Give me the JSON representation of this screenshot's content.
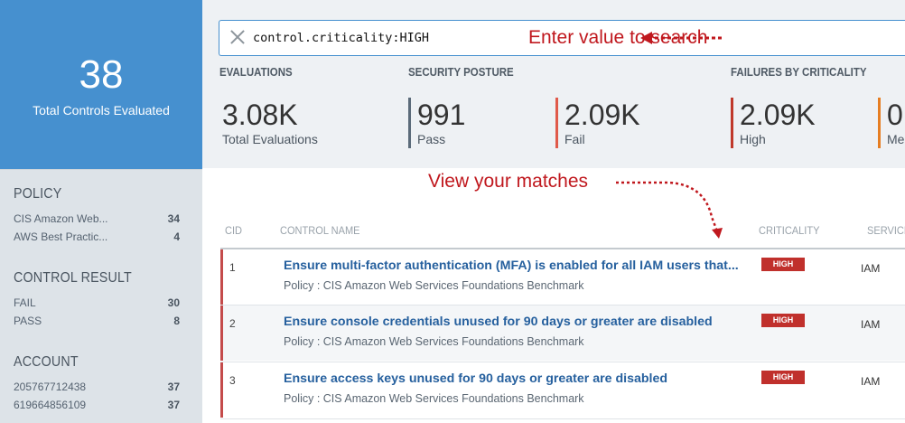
{
  "summary": {
    "total_count": "38",
    "total_label": "Total Controls Evaluated"
  },
  "facets": [
    {
      "title": "POLICY",
      "items": [
        {
          "label": "CIS Amazon Web...",
          "count": "34"
        },
        {
          "label": "AWS Best Practic...",
          "count": "4"
        }
      ]
    },
    {
      "title": "CONTROL RESULT",
      "items": [
        {
          "label": "FAIL",
          "count": "30"
        },
        {
          "label": "PASS",
          "count": "8"
        }
      ]
    },
    {
      "title": "ACCOUNT",
      "items": [
        {
          "label": "205767712438",
          "count": "37"
        },
        {
          "label": "619664856109",
          "count": "37"
        }
      ]
    }
  ],
  "search": {
    "query": "control.criticality:HIGH"
  },
  "annotations": {
    "search_hint": "Enter value to search",
    "matches_hint": "View your matches"
  },
  "sections": {
    "evaluations": "EVALUATIONS",
    "posture": "SECURITY POSTURE",
    "failures": "FAILURES BY CRITICALITY"
  },
  "metrics": [
    {
      "value": "3.08K",
      "label": "Total Evaluations"
    },
    {
      "value": "991",
      "label": "Pass",
      "color": "#5b6b7a"
    },
    {
      "value": "2.09K",
      "label": "Fail",
      "color": "#e05a4a"
    },
    {
      "value": "2.09K",
      "label": "High",
      "color": "#c0392b"
    },
    {
      "value": "0",
      "label": "Me",
      "color": "#e67e22"
    }
  ],
  "table": {
    "headers": {
      "cid": "CID",
      "name": "CONTROL NAME",
      "criticality": "CRITICALITY",
      "service": "SERVICE"
    },
    "rows": [
      {
        "cid": "1",
        "name": "Ensure multi-factor authentication (MFA) is enabled for all IAM users that...",
        "policy": "Policy : CIS Amazon Web Services Foundations Benchmark",
        "criticality": "HIGH",
        "service": "IAM"
      },
      {
        "cid": "2",
        "name": "Ensure console credentials unused for 90 days or greater are disabled",
        "policy": "Policy : CIS Amazon Web Services Foundations Benchmark",
        "criticality": "HIGH",
        "service": "IAM"
      },
      {
        "cid": "3",
        "name": "Ensure access keys unused for 90 days or greater are disabled",
        "policy": "Policy : CIS Amazon Web Services Foundations Benchmark",
        "criticality": "HIGH",
        "service": "IAM"
      }
    ]
  },
  "colors": {
    "accent": "#4690cf",
    "annotation": "#c0181e",
    "high_badge": "#c0302c",
    "link": "#26609e"
  }
}
